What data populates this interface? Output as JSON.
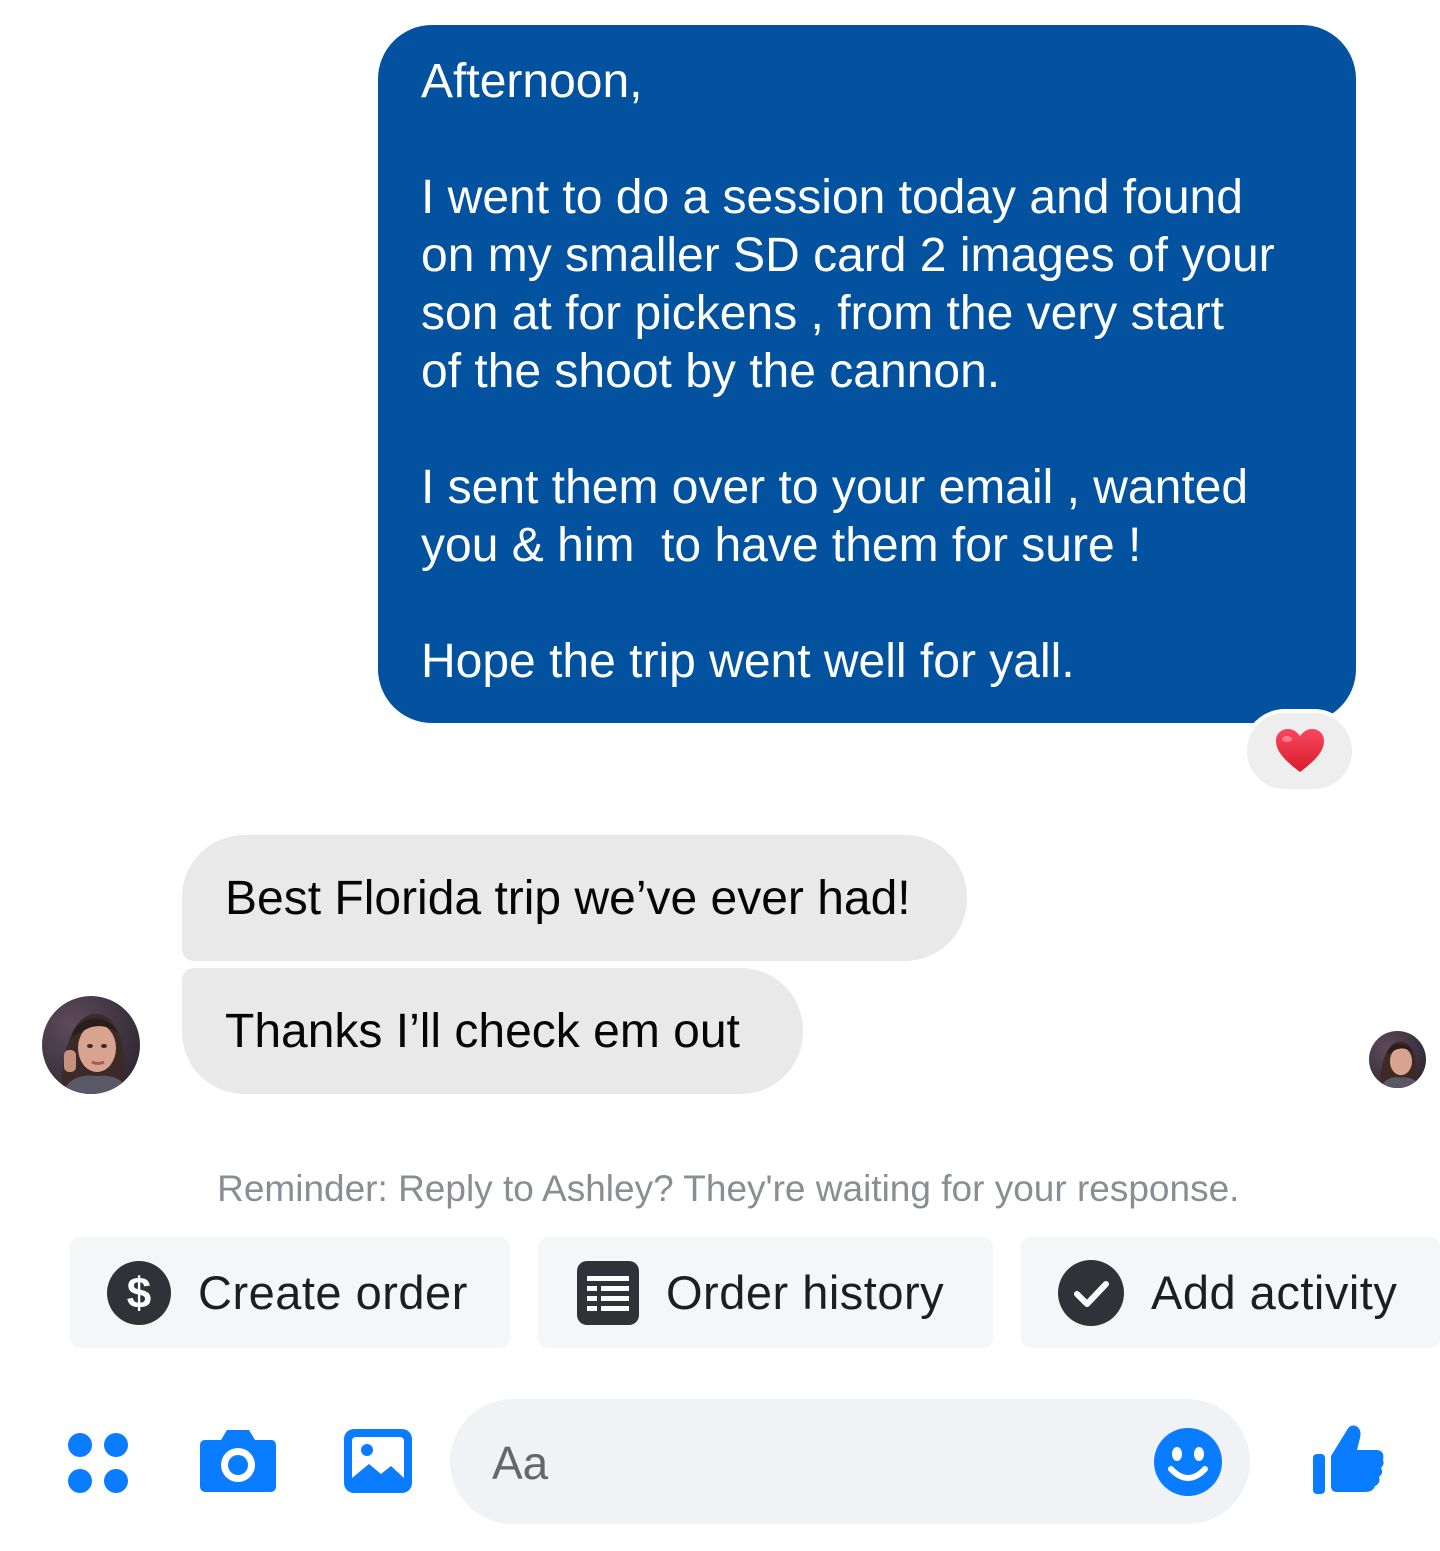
{
  "conversation": {
    "outgoing_message": {
      "lines": [
        "Afternoon,",
        "",
        "I went to do a session today and found",
        "on my smaller SD card 2 images of your",
        "son at for pickens , from the very start",
        "of the shoot by the cannon.",
        "",
        "I sent them over to your email , wanted",
        "you & him  to have them for sure !",
        "",
        "Hope the trip went well for yall."
      ],
      "reaction": "❤️"
    },
    "incoming_messages": [
      "Best Florida trip we’ve ever had!",
      "Thanks I’ll check em out"
    ],
    "reminder": "Reminder: Reply to Ashley? They're waiting for your response."
  },
  "actions": {
    "create_order": "Create order",
    "order_history": "Order history",
    "add_activity": "Add activity"
  },
  "composer": {
    "placeholder": "Aa"
  },
  "colors": {
    "outgoing_bubble": "#02529f",
    "incoming_bubble": "#e9e9e9",
    "messenger_blue": "#0a7cff",
    "chip_icon_dark": "#2f3338"
  },
  "icons": {
    "menu": "four-dots-icon",
    "camera": "camera-icon",
    "gallery": "image-icon",
    "emoji": "smiley-icon",
    "like": "thumbs-up-icon",
    "create_order": "dollar-icon",
    "order_history": "receipt-icon",
    "add_activity": "checkmark-icon"
  }
}
